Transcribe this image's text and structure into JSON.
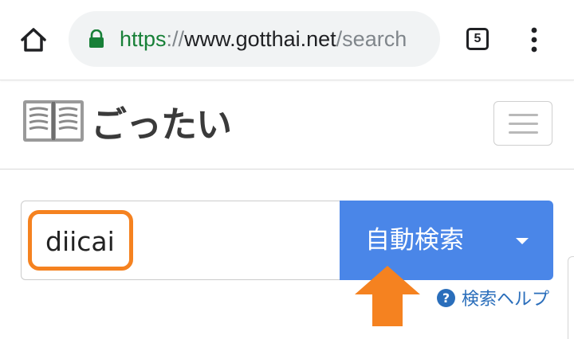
{
  "browser": {
    "url": {
      "scheme": "https",
      "separator": "://",
      "host": "www.gotthai.net",
      "path": "/search"
    },
    "tab_count": "5",
    "icons": {
      "home": "home-icon",
      "lock": "lock-icon",
      "menu": "more-vert-icon"
    }
  },
  "site": {
    "logo_text": "ごったい",
    "logo_icon": "open-book-icon",
    "menu_icon": "hamburger-icon"
  },
  "search": {
    "value": "diicai",
    "button_label": "自動検索",
    "dropdown_icon": "caret-down-icon",
    "help_label": "検索ヘルプ",
    "help_icon": "question-circle-icon"
  },
  "colors": {
    "accent_blue": "#4a86e8",
    "highlight_orange": "#f58220",
    "secure_green": "#188038",
    "link_blue": "#2a6ebb"
  }
}
